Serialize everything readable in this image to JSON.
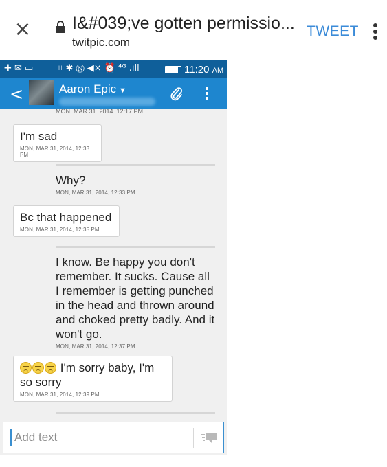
{
  "browser": {
    "close_glyph": "×",
    "title": "I&#039;ve gotten permissio...",
    "domain": "twitpic.com",
    "tweet_label": "TWEET",
    "icons": [
      "close-icon",
      "lock-icon",
      "more-vert-icon"
    ]
  },
  "status_bar": {
    "left_icons": "✚ ✉ ▭",
    "mid_icons": "⌗ ✱ Ⓝ ◀× ⏰ ⁴ᴳ .ıll",
    "time": "11:20",
    "ampm": "AM"
  },
  "action_bar": {
    "back_glyph": "<",
    "contact_name": "Aaron Epic",
    "caret": "▼",
    "icons": [
      "back-icon",
      "paperclip-icon",
      "overflow-menu-icon"
    ]
  },
  "conversation": {
    "cut_timestamp": "MON, MAR 31, 2014, 12:17 PM",
    "messages": [
      {
        "direction": "incoming",
        "text": "I'm sad",
        "time": "MON, MAR 31, 2014, 12:33 PM"
      },
      {
        "direction": "outgoing",
        "text": "Why?",
        "time": "MON, MAR 31, 2014, 12:33 PM"
      },
      {
        "direction": "incoming",
        "text": "Bc that happened",
        "time": "MON, MAR 31, 2014, 12:35 PM"
      },
      {
        "direction": "outgoing",
        "text": "I know. Be happy you don't remember. It sucks. Cause all I remember is getting punched in the head and thrown around and choked pretty badly. And it won't go.",
        "time": "MON, MAR 31, 2014, 12:37 PM"
      },
      {
        "direction": "incoming",
        "text": "I'm sorry baby, I'm so sorry",
        "emoji_count": 3,
        "time": "MON, MAR 31, 2014, 12:39 PM"
      }
    ]
  },
  "compose": {
    "placeholder": "Add text",
    "icons": [
      "send-icon"
    ]
  },
  "colors": {
    "status_bar": "#0f5f9a",
    "action_bar": "#1e86cf",
    "tweet_accent": "#3b8bd8",
    "conversation_bg": "#f0f0f0"
  }
}
